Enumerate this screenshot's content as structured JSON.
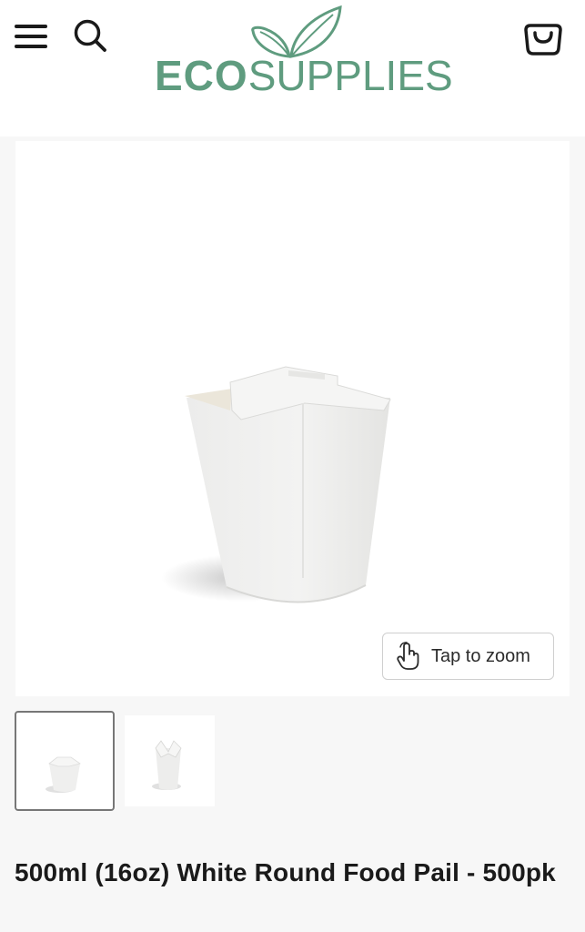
{
  "header": {
    "logo_bold": "ECO",
    "logo_light": "SUPPLIES",
    "brand_color": "#5f9c7f",
    "icons": [
      "menu-icon",
      "search-icon",
      "shopping-bag-icon"
    ]
  },
  "gallery": {
    "zoom_label": "Tap to zoom",
    "zoom_icon": "tap-hand-icon",
    "thumbnails": [
      {
        "state": "selected"
      },
      {
        "state": "unselected"
      }
    ]
  },
  "product": {
    "title": "500ml (16oz) White Round Food Pail - 500pk"
  }
}
